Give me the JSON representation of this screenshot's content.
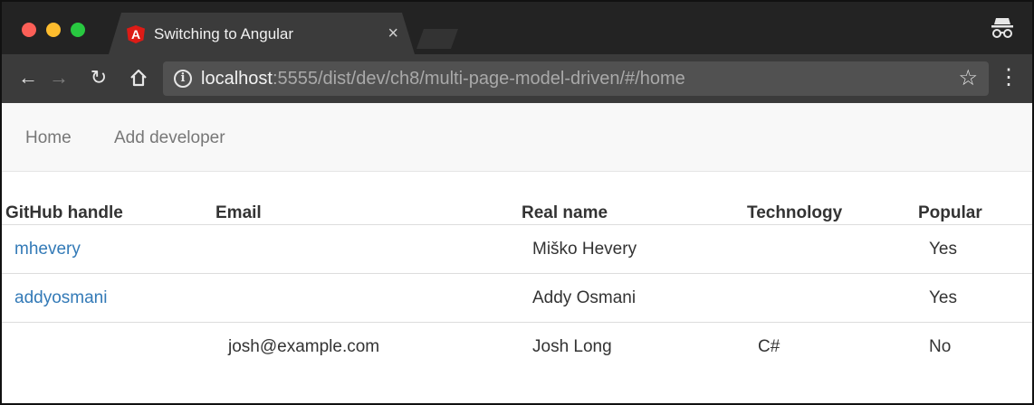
{
  "browser": {
    "tab_title": "Switching to Angular",
    "tab_favicon": "A",
    "tab_close": "×",
    "url_host": "localhost",
    "url_rest": ":5555/dist/dev/ch8/multi-page-model-driven/#/home",
    "icons": [
      "back-arrow-icon",
      "forward-arrow-icon",
      "reload-icon",
      "home-icon",
      "info-icon",
      "star-icon",
      "menu-icon",
      "incognito-icon"
    ],
    "colors": {
      "close": "#fc5f57",
      "minimize": "#fdbc2e",
      "maximize": "#28c840"
    }
  },
  "navbar": {
    "home_label": "Home",
    "add_developer_label": "Add developer"
  },
  "table": {
    "headers": [
      "GitHub handle",
      "Email",
      "Real name",
      "Technology",
      "Popular"
    ],
    "rows": [
      {
        "github": "mhevery",
        "email": "",
        "name": "Miško Hevery",
        "technology": "",
        "popular": "Yes"
      },
      {
        "github": "addyosmani",
        "email": "",
        "name": "Addy Osmani",
        "technology": "",
        "popular": "Yes"
      },
      {
        "github": "",
        "email": "josh@example.com",
        "name": "Josh Long",
        "technology": "C#",
        "popular": "No"
      }
    ],
    "link_color": "#337ab7"
  }
}
